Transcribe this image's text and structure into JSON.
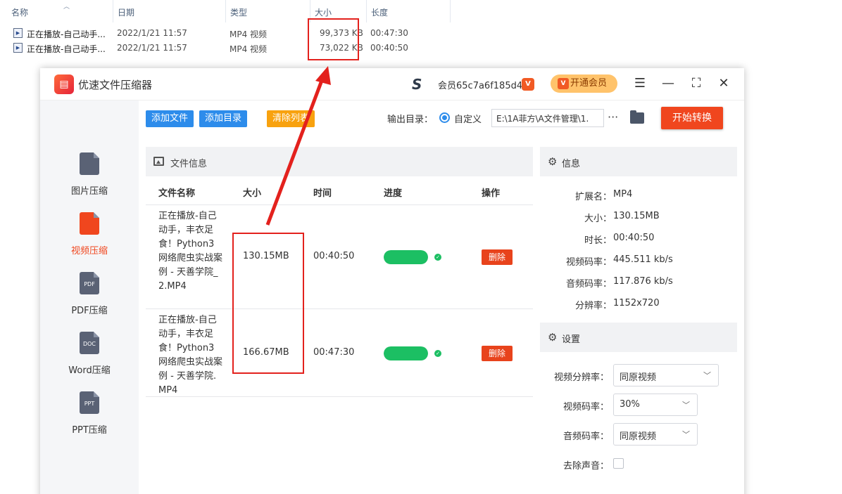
{
  "explorer": {
    "columns": [
      "名称",
      "日期",
      "类型",
      "大小",
      "长度"
    ],
    "rows": [
      {
        "name": "正在播放-自己动手...",
        "date": "2022/1/21 11:57",
        "type": "MP4 视频",
        "size": "99,373 KB",
        "length": "00:47:30"
      },
      {
        "name": "正在播放-自己动手...",
        "date": "2022/1/21 11:57",
        "type": "MP4 视频",
        "size": "73,022 KB",
        "length": "00:40:50"
      }
    ]
  },
  "app": {
    "title": "优速文件压缩器",
    "member_id": "会员65c7a6f185d4",
    "vip_button": "开通会员",
    "window_icons": [
      "menu-icon",
      "minimize-icon",
      "maximize-icon",
      "close-icon"
    ]
  },
  "sidebar": {
    "items": [
      {
        "label": "图片压缩",
        "icon_text": "",
        "active": false
      },
      {
        "label": "视频压缩",
        "icon_text": "",
        "active": true
      },
      {
        "label": "PDF压缩",
        "icon_text": "PDF",
        "active": false
      },
      {
        "label": "Word压缩",
        "icon_text": "DOC",
        "active": false
      },
      {
        "label": "PPT压缩",
        "icon_text": "PPT",
        "active": false
      }
    ]
  },
  "toolbar": {
    "add_file": "添加文件",
    "add_dir": "添加目录",
    "clear_list": "清除列表",
    "output_label": "输出目录：",
    "output_option": "自定义",
    "output_path": "E:\\1A菲方\\A文件管理\\1.",
    "more": "···",
    "start": "开始转换"
  },
  "file_panel": {
    "title": "文件信息",
    "headers": {
      "name": "文件名称",
      "size": "大小",
      "time": "时间",
      "progress": "进度",
      "action": "操作"
    },
    "rows": [
      {
        "name": "正在播放-自己动手，丰衣足食！Python3网络爬虫实战案例 - 天善学院_2.MP4",
        "size": "130.15MB",
        "time": "00:40:50",
        "progress": 1.0,
        "action": "删除"
      },
      {
        "name": "正在播放-自己动手，丰衣足食！Python3网络爬虫实战案例 - 天善学院.MP4",
        "size": "166.67MB",
        "time": "00:47:30",
        "progress": 1.0,
        "action": "删除"
      }
    ]
  },
  "info": {
    "title": "信息",
    "items": [
      {
        "key": "扩展名：",
        "value": "MP4"
      },
      {
        "key": "大小：",
        "value": "130.15MB"
      },
      {
        "key": "时长：",
        "value": "00:40:50"
      },
      {
        "key": "视频码率：",
        "value": "445.511 kb/s"
      },
      {
        "key": "音频码率：",
        "value": "117.876 kb/s"
      },
      {
        "key": "分辨率：",
        "value": "1152x720"
      }
    ]
  },
  "settings": {
    "title": "设置",
    "video_resolution_label": "视频分辨率：",
    "video_resolution_value": "同原视频",
    "video_bitrate_label": "视频码率：",
    "video_bitrate_value": "30%",
    "audio_bitrate_label": "音频码率：",
    "audio_bitrate_value": "同原视频",
    "remove_audio_label": "去除声音：",
    "remove_audio_checked": false
  },
  "colors": {
    "accent_orange": "#f0461e",
    "primary_blue": "#2d8ceb",
    "clear_orange": "#f8a20f",
    "success_green": "#1cbf63",
    "annotation_red": "#e3211d"
  }
}
